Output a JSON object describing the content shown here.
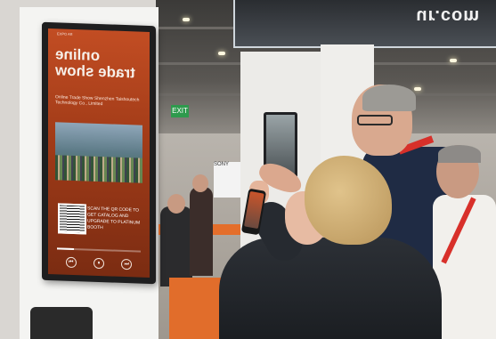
{
  "banner": {
    "text": "ur.com"
  },
  "kiosk": {
    "mini_logo": "EXPO AR",
    "title_line1": "online",
    "title_line2": "trade show",
    "brand_a": "Online Trade Show",
    "brand_b": "Shenzhen Taishoutech Technology Co., Limited",
    "qr_caption": "SCAN THE QR CODE TO GET CATALOG AND UPGRADE TO PLATINUM BOOTH",
    "controls": [
      "⏮",
      "⏸",
      "⏭"
    ],
    "progress": 0.2
  },
  "background": {
    "sony_label": "SONY",
    "exit_label": "EXIT"
  },
  "colors": {
    "kiosk_orange": "#c24d23",
    "lanyard_red": "#d7302a",
    "booth_orange": "#e16d2b"
  }
}
